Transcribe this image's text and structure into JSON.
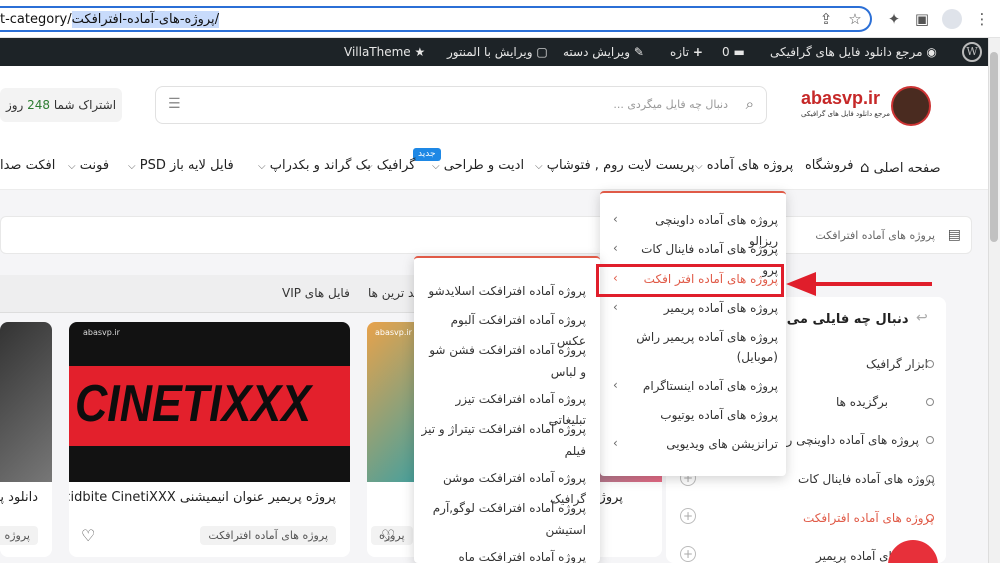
{
  "browser": {
    "url_prefix": "t-category/",
    "url_selected": "پروژه-های-آماده-افترافکت/",
    "icons": [
      "share-icon",
      "star-icon",
      "extension-icon",
      "sidepanel-icon",
      "profile-icon",
      "more-icon"
    ]
  },
  "adminbar": {
    "site": "مرجع دانلود فایل های گرافیکی",
    "comments": "0",
    "new": "تازه",
    "edit_category": "ویرایش دسته",
    "edit_elementor": "ویرایش با المنتور",
    "theme": "VillaTheme"
  },
  "header": {
    "logo_text": "abasvp.ir",
    "logo_sub": "مرجع دانلود فایل های گرافیکی",
    "search_placeholder": "دنبال چه فایل میگردی ...",
    "subscription_label": "اشتراک شما",
    "subscription_days": "248",
    "subscription_unit": "روز"
  },
  "nav": {
    "home": "صفحه اصلی",
    "shop": "فروشگاه",
    "ready_projects": "پروژه های آماده",
    "presets": "پریست لایت روم , فتوشاپ",
    "edit_design": "ادیت و طراحی",
    "graphic": "گرافیک",
    "new_badge": "جدید",
    "backgrounds": "بک گراند و بکدراپ",
    "psd": "فایل لایه باز PSD",
    "font": "فونت",
    "sound": "افکت صدا"
  },
  "breadcrumb": {
    "label": "پروژه های آماده افترافکت"
  },
  "tabs": {
    "vip": "فایل های VIP",
    "newest": "جدید ترین ها"
  },
  "cards": [
    {
      "title": "پروژه پریمیر عنوان انیمیشنی Acidbite CinetiXXX",
      "tag": "پروژه های آماده افترافکت",
      "img_title": "CINETIXXX",
      "watermark": "abasvp.ir"
    },
    {
      "title": "دانلود پر",
      "tag": "پروژه"
    },
    {
      "title": "پروژه ا",
      "tag": "پروژه",
      "watermark": "abasvp.ir"
    }
  ],
  "sidebar": {
    "title": "دنبال چه فایلی می گردید؟",
    "items": [
      "ابزار گرافیک",
      "برگزیده ها",
      "پروژه های آماده داوینچی ریزالو",
      "پروژه های آماده فاینال کات",
      "پروژه های آماده افترافکت",
      "پروژه های آماده پریمیر"
    ]
  },
  "dropdown": {
    "items": [
      "پروژه های آماده داوینچی ریزالو",
      "پروژه های آماده فاینال کات پرو",
      "پروژه های آماده افتر افکت",
      "پروژه های آماده پریمیر",
      "پروژه های آماده پریمیر راش (موبایل)",
      "پروژه های آماده اینستاگرام",
      "پروژه های آماده یوتیوب",
      "ترانزیشن های ویدیویی"
    ]
  },
  "submenu": {
    "items": [
      "پروژه آماده افترافکت اسلایدشو",
      "پروژه آماده افترافکت آلبوم عکس",
      "پروژه آماده افترافکت فشن شو و لباس",
      "پروژه آماده افترافکت تیزر تبلیغاتی",
      "پروژه آماده افترافکت تیتراژ و تیز فیلم",
      "پروژه آماده افترافکت موشن گرافیک",
      "پروژه آماده افترافکت لوگو,آرم استیشن",
      "پروژه آماده افترافکت ماه رمضان"
    ]
  },
  "colors": {
    "accent": "#e05a47",
    "highlight": "#e01e2b",
    "admin_bg": "#1d2327",
    "link_blue": "#2b6fd6"
  }
}
